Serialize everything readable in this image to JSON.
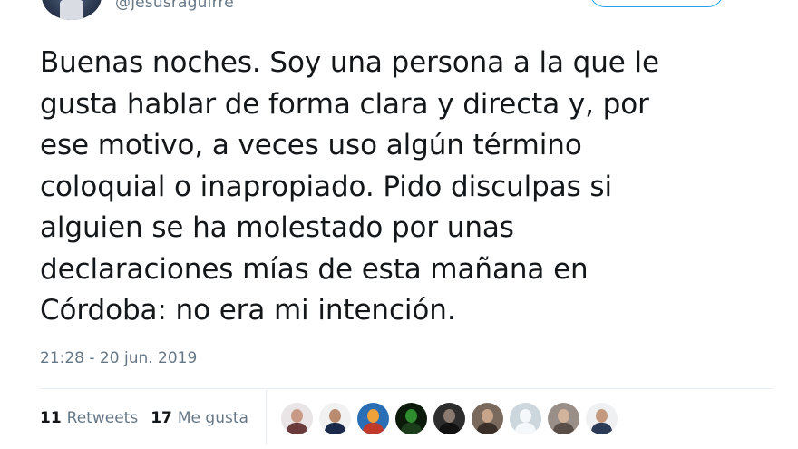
{
  "author": {
    "handle": "@jesusraguirre"
  },
  "tweet": {
    "text": "Buenas noches. Soy una persona a la que le\ngusta hablar de forma clara y directa y, por\nese motivo, a veces uso algún término\ncoloquial o inapropiado. Pido disculpas si\nalguien se ha molestado por unas\ndeclaraciones mías de esta mañana en\nCórdoba: no era mi intención.",
    "timestamp": "21:28 - 20 jun. 2019"
  },
  "stats": {
    "retweets_count": "11",
    "retweets_label": "Retweets",
    "likes_count": "17",
    "likes_label": "Me gusta"
  },
  "colors": {
    "accent": "#1da1f2",
    "text": "#14171a",
    "muted": "#657786"
  },
  "likers": [
    {
      "icon": "avatar-woman-icon",
      "bg": "#e9e4e6",
      "face": "#c89a85",
      "body": "#6b3a3a"
    },
    {
      "icon": "avatar-man-icon",
      "bg": "#f1f1f1",
      "face": "#b98b70",
      "body": "#1b2a4a"
    },
    {
      "icon": "avatar-cartoon-icon",
      "bg": "#2a6fb6",
      "face": "#f0a23a",
      "body": "#c0392b"
    },
    {
      "icon": "avatar-text-icon",
      "bg": "#0b1a0b",
      "face": "#2e8b2e",
      "body": "#1c3d1c"
    },
    {
      "icon": "avatar-man-icon",
      "bg": "#2d2d2d",
      "face": "#8a7a70",
      "body": "#111111"
    },
    {
      "icon": "avatar-man-icon",
      "bg": "#7a6a5e",
      "face": "#c8a48a",
      "body": "#3a2f28"
    },
    {
      "icon": "avatar-default-icon",
      "bg": "#ccd6dd",
      "face": "#f5f8fa",
      "body": "#f5f8fa"
    },
    {
      "icon": "avatar-man-icon",
      "bg": "#9a8f88",
      "face": "#d2b49c",
      "body": "#5a4f48"
    },
    {
      "icon": "avatar-man-icon",
      "bg": "#eef0f2",
      "face": "#c49a7e",
      "body": "#2b3a55"
    }
  ]
}
